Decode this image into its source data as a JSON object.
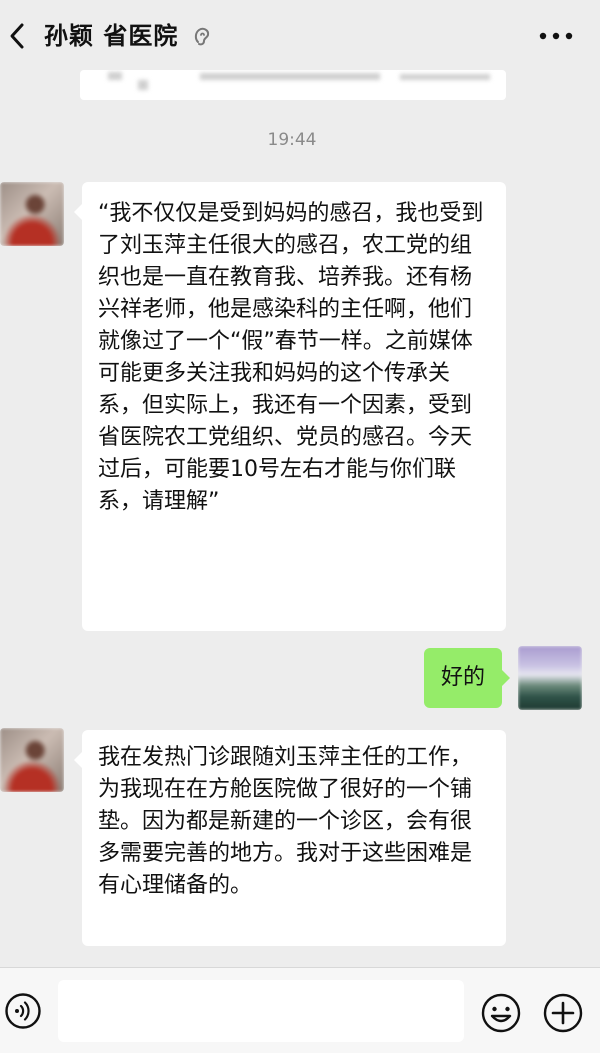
{
  "header": {
    "title": "孙颖 省医院",
    "back_icon": "chevron-left-icon",
    "mute_icon": "ear-icon",
    "more_icon": "more-horizontal-icon"
  },
  "chat": {
    "timestamp": "19:44",
    "messages": [
      {
        "side": "left",
        "text": "“我不仅仅是受到妈妈的感召，我也受到了刘玉萍主任很大的感召，农工党的组织也是一直在教育我、培养我。还有杨兴祥老师，他是感染科的主任啊，他们就像过了一个“假”春节一样。之前媒体可能更多关注我和妈妈的这个传承关系，但实际上，我还有一个因素，受到省医院农工党组织、党员的感召。今天过后，可能要10号左右才能与你们联系，请理解”"
      },
      {
        "side": "right",
        "text": "好的"
      },
      {
        "side": "left",
        "text": "我在发热门诊跟随刘玉萍主任的工作，为我现在在方舱医院做了很好的一个铺垫。因为都是新建的一个诊区，会有很多需要完善的地方。我对于这些困难是有心理储备的。"
      }
    ]
  },
  "input_bar": {
    "placeholder": "",
    "voice_icon": "voice-icon",
    "emoji_icon": "emoji-icon",
    "plus_icon": "plus-icon"
  },
  "colors": {
    "background": "#ededed",
    "bubble_incoming": "#ffffff",
    "bubble_outgoing": "#95ec69",
    "timestamp": "#8a8a8a"
  }
}
